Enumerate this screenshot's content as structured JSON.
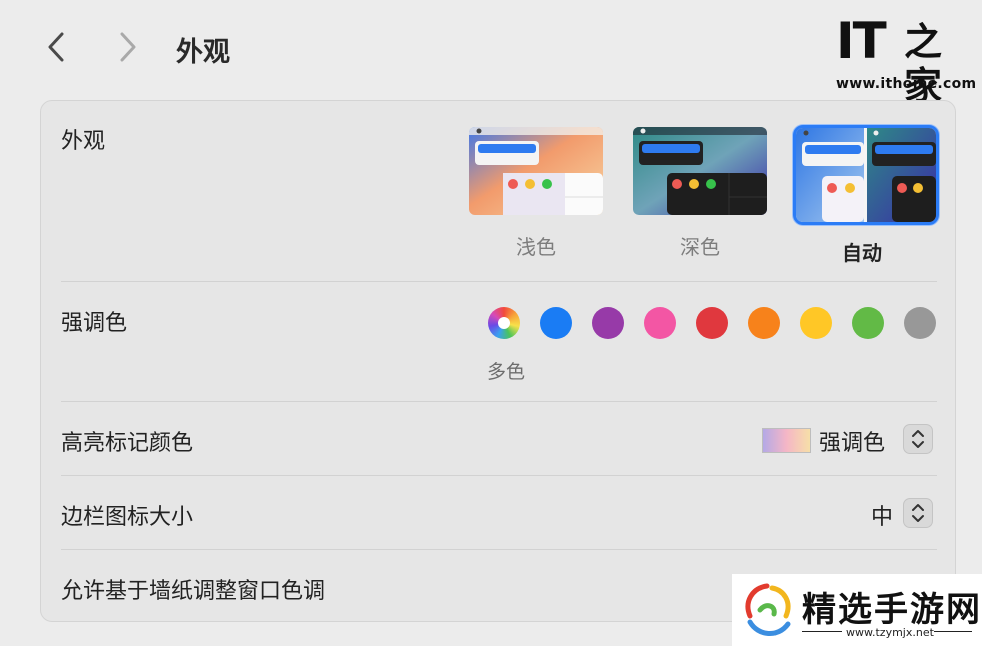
{
  "header": {
    "title": "外观",
    "back_icon": "chevron-left-icon",
    "forward_icon": "chevron-right-icon"
  },
  "brand_logo": {
    "mark": "IT",
    "mark2": "之家",
    "url": "www.ithome.com"
  },
  "appearance": {
    "label": "外观",
    "themes": [
      {
        "label": "浅色",
        "selected": false
      },
      {
        "label": "深色",
        "selected": false
      },
      {
        "label": "自动",
        "selected": true
      }
    ]
  },
  "accent": {
    "label": "强调色",
    "selected_label": "多色",
    "colors": [
      "multicolor",
      "#1a7cf4",
      "#973aa8",
      "#f356a4",
      "#e0383e",
      "#f7821b",
      "#ffc726",
      "#62ba46",
      "#989898"
    ]
  },
  "highlight": {
    "label": "高亮标记颜色",
    "value": "强调色"
  },
  "sidebar_icon_size": {
    "label": "边栏图标大小",
    "value": "中"
  },
  "wallpaper_tinting": {
    "label": "允许基于墙纸调整窗口色调"
  },
  "watermark": {
    "name": "精选手游网",
    "url": "www.tzymjx.net"
  }
}
